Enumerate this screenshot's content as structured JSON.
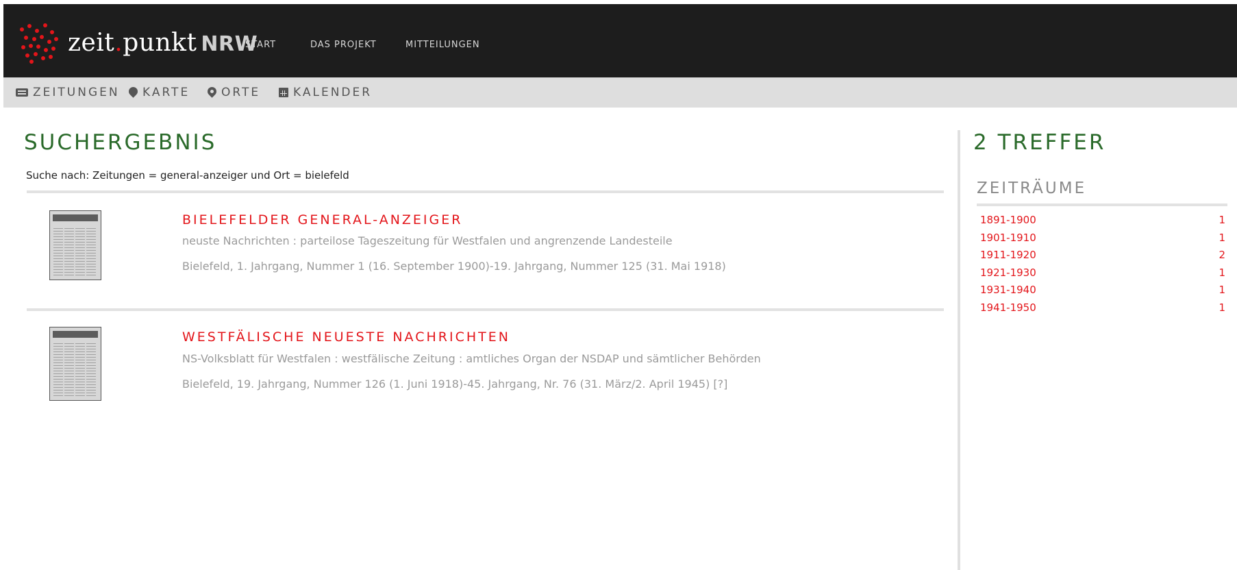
{
  "header": {
    "logo": {
      "word1": "zeit",
      "dot": ".",
      "word2": "punkt",
      "suffix": "NRW"
    },
    "nav": [
      "START",
      "DAS PROJEKT",
      "MITTEILUNGEN"
    ]
  },
  "subnav": {
    "items": [
      {
        "icon": "newspaper-icon",
        "label": "ZEITUNGEN"
      },
      {
        "icon": "map-pin-icon",
        "label": "KARTE"
      },
      {
        "icon": "location-marker-icon",
        "label": "ORTE"
      },
      {
        "icon": "calendar-icon",
        "label": "KALENDER"
      }
    ]
  },
  "results": {
    "title": "SUCHERGEBNIS",
    "query": "Suche nach: Zeitungen = general-anzeiger und Ort = bielefeld",
    "items": [
      {
        "title": "BIELEFELDER GENERAL-ANZEIGER",
        "subtitle": "neuste Nachrichten : parteilose Tageszeitung für Westfalen und angrenzende Landesteile",
        "details": "Bielefeld, 1. Jahrgang, Nummer 1 (16. September 1900)-19. Jahrgang, Nummer 125 (31. Mai 1918)"
      },
      {
        "title": "WESTFÄLISCHE NEUESTE NACHRICHTEN",
        "subtitle": "NS-Volksblatt für Westfalen : westfälische Zeitung : amtliches Organ der NSDAP und sämtlicher Behörden",
        "details": "Bielefeld, 19. Jahrgang, Nummer 126 (1. Juni 1918)-45. Jahrgang, Nr. 76 (31. März/2. April 1945) [?]"
      }
    ]
  },
  "sidebar": {
    "hits": "2 TREFFER",
    "facet_title": "ZEITRÄUME",
    "facets": [
      {
        "label": "1891-1900",
        "count": "1"
      },
      {
        "label": "1901-1910",
        "count": "1"
      },
      {
        "label": "1911-1920",
        "count": "2"
      },
      {
        "label": "1921-1930",
        "count": "1"
      },
      {
        "label": "1931-1940",
        "count": "1"
      },
      {
        "label": "1941-1950",
        "count": "1"
      }
    ]
  },
  "colors": {
    "accent_red": "#e3151a",
    "heading_green": "#2a6a2a",
    "topbar_bg": "#1d1d1d",
    "subbar_bg": "#dedede"
  }
}
